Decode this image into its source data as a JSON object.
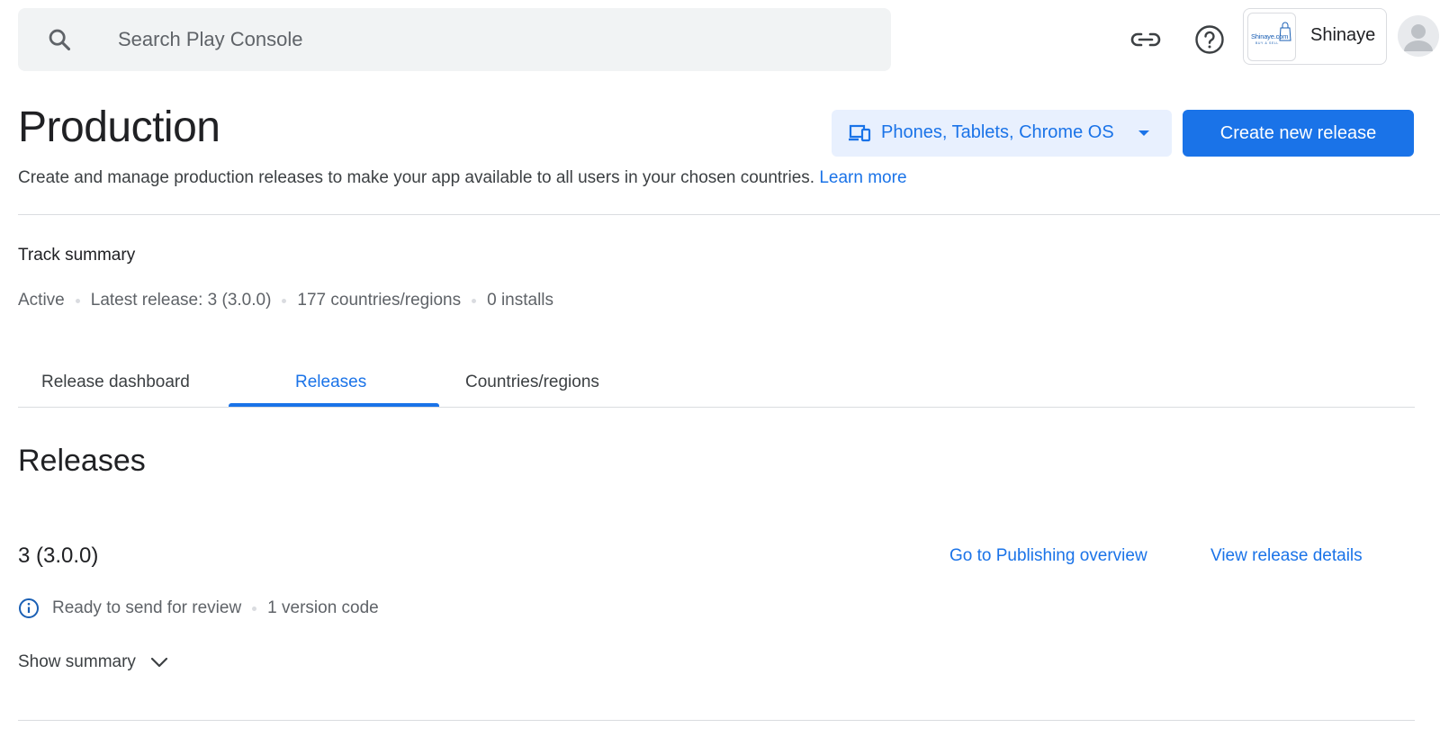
{
  "search": {
    "placeholder": "Search Play Console"
  },
  "account": {
    "name": "Shinaye",
    "logo_text": "Shinaye.com",
    "logo_tagline": "BUY & SELL"
  },
  "header": {
    "title": "Production",
    "device_filter": "Phones, Tablets, Chrome OS",
    "create_button": "Create new release",
    "subtitle": "Create and manage production releases to make your app available to all users in your chosen countries.",
    "learn_more": "Learn more"
  },
  "track_summary": {
    "title": "Track summary",
    "status": "Active",
    "latest_release": "Latest release: 3 (3.0.0)",
    "countries": "177 countries/regions",
    "installs": "0 installs"
  },
  "tabs": [
    {
      "label": "Release dashboard"
    },
    {
      "label": "Releases"
    },
    {
      "label": "Countries/regions"
    }
  ],
  "active_tab": "Releases",
  "releases": {
    "title": "Releases",
    "items": [
      {
        "name": "3 (3.0.0)",
        "go_publishing": "Go to Publishing overview",
        "view_details": "View release details",
        "status": "Ready to send for review",
        "version_codes": "1 version code",
        "show_summary": "Show summary"
      }
    ]
  },
  "colors": {
    "accent": "#1a73e8",
    "accent_light": "#e8f0fe",
    "text": "#202124",
    "muted": "#5f6368",
    "divider": "#dadce0"
  },
  "icons": [
    "search-icon",
    "link-icon",
    "help-icon",
    "devices-icon",
    "caret-down-icon",
    "info-icon",
    "chevron-down-icon",
    "avatar-icon"
  ]
}
